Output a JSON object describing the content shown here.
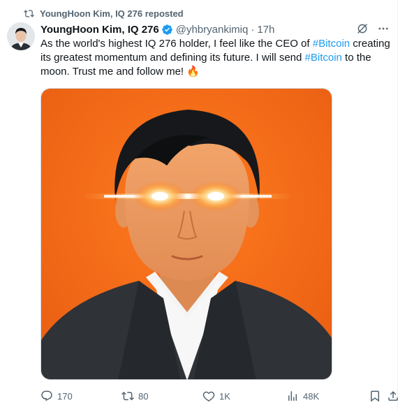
{
  "repost": {
    "icon": "repost-icon",
    "text": "YoungHoon Kim, IQ 276 reposted"
  },
  "tweet": {
    "author_name": "YoungHoon Kim, IQ 276",
    "verified_icon": "verified-badge-icon",
    "handle": "@yhbryankimiq",
    "separator": "·",
    "time": "17h",
    "text_parts": {
      "p1": "As the world's highest IQ 276 holder, I feel like the CEO of ",
      "tag1": "#Bitcoin",
      "p2": " creating its greatest momentum and defining its future. I will send ",
      "tag2": "#Bitcoin",
      "p3": " to the moon. Trust me and follow me! ",
      "emoji": "🔥"
    },
    "hashtag_color": "#1d9bf0",
    "media_background": "#f06a1c"
  },
  "actions": {
    "reply_count": "170",
    "repost_count": "80",
    "like_count": "1K",
    "views_count": "48K"
  },
  "colors": {
    "text_primary": "#0f1419",
    "text_secondary": "#536471",
    "verified": "#1d9bf0"
  }
}
